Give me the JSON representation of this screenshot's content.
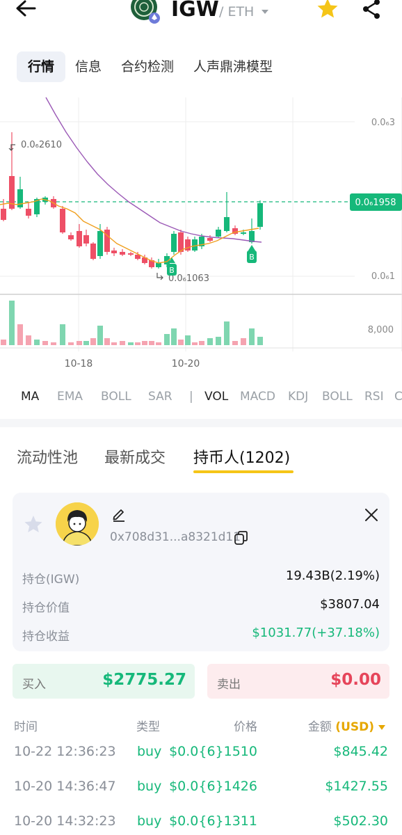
{
  "header": {
    "token_name": "IGW",
    "chain": "/ ETH"
  },
  "top_tabs": [
    "行情",
    "信息",
    "合约检测",
    "人声鼎沸模型"
  ],
  "chart": {
    "price_high_label": "0.0₆3",
    "price_low_label": "0.0₆1",
    "current_price_label": "0.0₆1958",
    "max_marker_label": "0.0₆2610",
    "min_marker_label": "0.0₆1063",
    "volume_label": "8,000",
    "date_labels": [
      "10-18",
      "10-20"
    ],
    "buy_marker": "B",
    "colors": {
      "up": "#16b87a",
      "down": "#ee4f66",
      "ma_fast": "#f0a020",
      "ma_slow": "#9b59b6"
    }
  },
  "indicator_tabs": {
    "main": [
      "MA",
      "EMA",
      "BOLL",
      "SAR"
    ],
    "separator": "|",
    "sub": [
      "VOL",
      "MACD",
      "KDJ",
      "BOLL",
      "RSI",
      "C"
    ]
  },
  "section_tabs": [
    "流动性池",
    "最新成交",
    "持币人(1202)"
  ],
  "holder": {
    "address": "0x708d31...a8321d11",
    "rows": [
      {
        "label": "持仓(IGW)",
        "value": "19.43B(2.19%)"
      },
      {
        "label": "持仓价值",
        "value": "$3807.04"
      },
      {
        "label": "持仓收益",
        "value": "$1031.77(+37.18%)"
      }
    ]
  },
  "buy": {
    "label": "买入",
    "value": "$2775.27"
  },
  "sell": {
    "label": "卖出",
    "value": "$0.00"
  },
  "trades": {
    "headers": {
      "time": "时间",
      "type": "类型",
      "price": "价格",
      "amount": "金额",
      "currency": "(USD)"
    },
    "rows": [
      {
        "time": "10-22 12:36:23",
        "type": "buy",
        "price": "$0.0{6}1510",
        "amount": "$845.42"
      },
      {
        "time": "10-20 14:36:47",
        "type": "buy",
        "price": "$0.0{6}1426",
        "amount": "$1427.55"
      },
      {
        "time": "10-20 14:32:23",
        "type": "buy",
        "price": "$0.0{6}1311",
        "amount": "$502.30"
      }
    ]
  }
}
